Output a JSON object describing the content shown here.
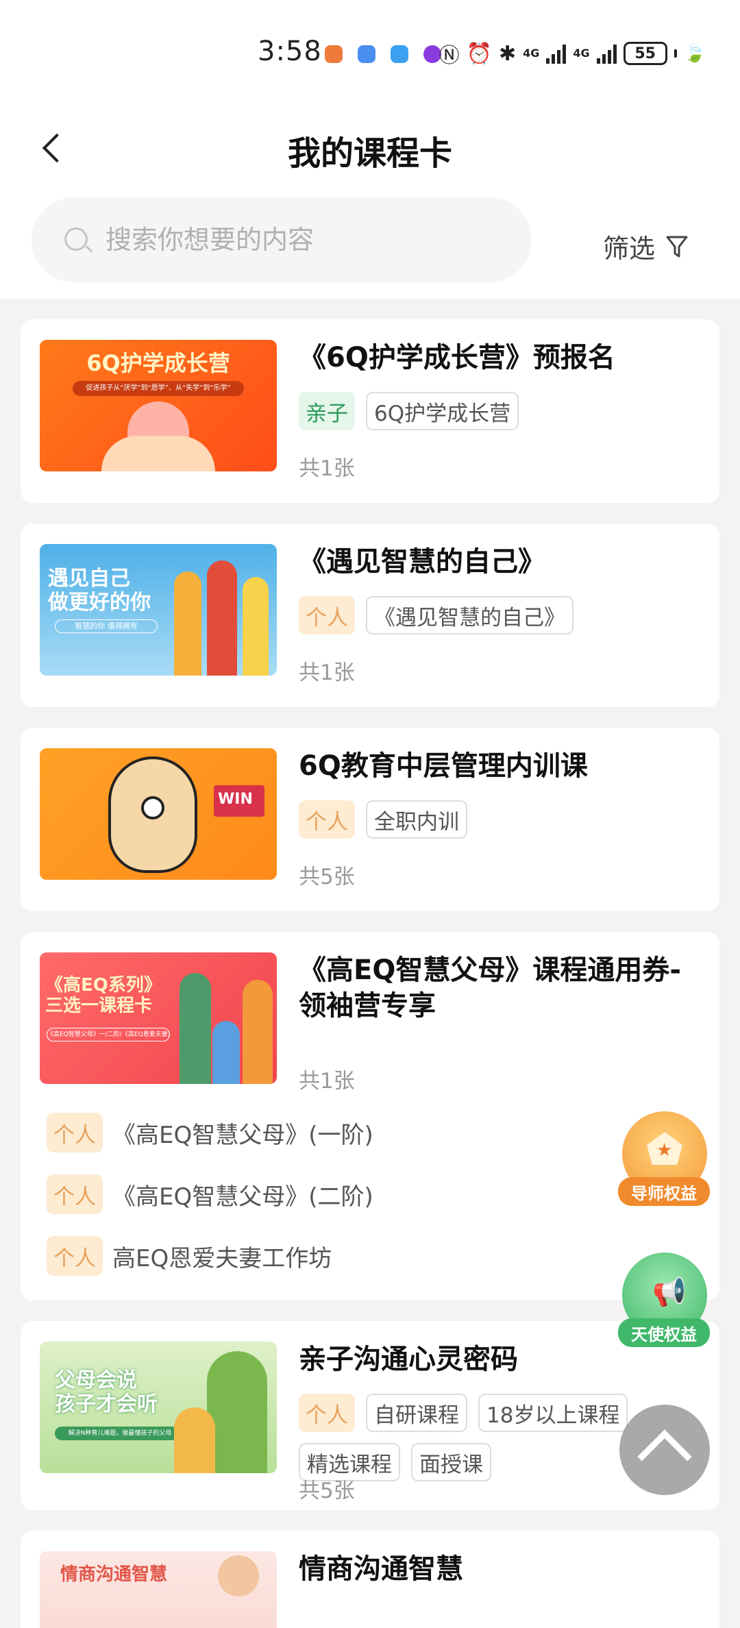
{
  "status_bar": {
    "time": "3:58",
    "battery": "55",
    "network_1": "4G",
    "network_2": "4G"
  },
  "header": {
    "title": "我的课程卡"
  },
  "search": {
    "placeholder": "搜索你想要的内容",
    "filter_label": "筛选"
  },
  "courses": [
    {
      "title": "《6Q护学成长营》预报名",
      "thumb_text": "6Q护学成长营",
      "thumb_sub": "促进孩子从“厌学”到“愿学”、从“失学”到“乐学”",
      "tags": [
        {
          "text": "亲子",
          "style": "green"
        },
        {
          "text": "6Q护学成长营",
          "style": "outline"
        }
      ],
      "count": "共1张"
    },
    {
      "title": "《遇见智慧的自己》",
      "thumb_text": "遇见自己\n做更好的你",
      "thumb_sub": "智慧的你 值得拥有",
      "tags": [
        {
          "text": "个人",
          "style": "orange"
        },
        {
          "text": "《遇见智慧的自己》",
          "style": "outline"
        }
      ],
      "count": "共1张"
    },
    {
      "title": "6Q教育中层管理内训课",
      "thumb_flag": "WIN",
      "tags": [
        {
          "text": "个人",
          "style": "orange"
        },
        {
          "text": "全职内训",
          "style": "outline"
        }
      ],
      "count": "共5张"
    },
    {
      "title": "《高EQ智慧父母》课程通用券-领袖营专享",
      "thumb_text": "《高EQ系列》\n三选一课程卡",
      "thumb_sub": "《高EQ智慧父母》一/二阶/《高EQ恩爱夫妻》",
      "count": "共1张",
      "items": [
        {
          "tag": "个人",
          "text": "《高EQ智慧父母》(一阶)"
        },
        {
          "tag": "个人",
          "text": "《高EQ智慧父母》(二阶)"
        },
        {
          "tag": "个人",
          "text": "高EQ恩爱夫妻工作坊"
        }
      ]
    },
    {
      "title": "亲子沟通心灵密码",
      "thumb_text": "父母会说\n孩子才会听",
      "thumb_sub": "解决N种育儿难题，做最懂孩子的父母",
      "tags": [
        {
          "text": "个人",
          "style": "orange"
        },
        {
          "text": "自研课程",
          "style": "outline"
        },
        {
          "text": "18岁以上课程",
          "style": "outline"
        },
        {
          "text": "精选课程",
          "style": "outline"
        },
        {
          "text": "面授课",
          "style": "outline"
        }
      ],
      "count": "共5张"
    },
    {
      "title": "情商沟通智慧",
      "thumb_text": "情商沟通智慧"
    }
  ],
  "floating": {
    "mentor_label": "导师权益",
    "angel_label": "天使权益"
  },
  "colors": {
    "tag_green_bg": "#e5f6ea",
    "tag_orange_bg": "#fdebd2",
    "mentor_orange": "#f08a2c",
    "angel_green": "#3fb86a"
  }
}
